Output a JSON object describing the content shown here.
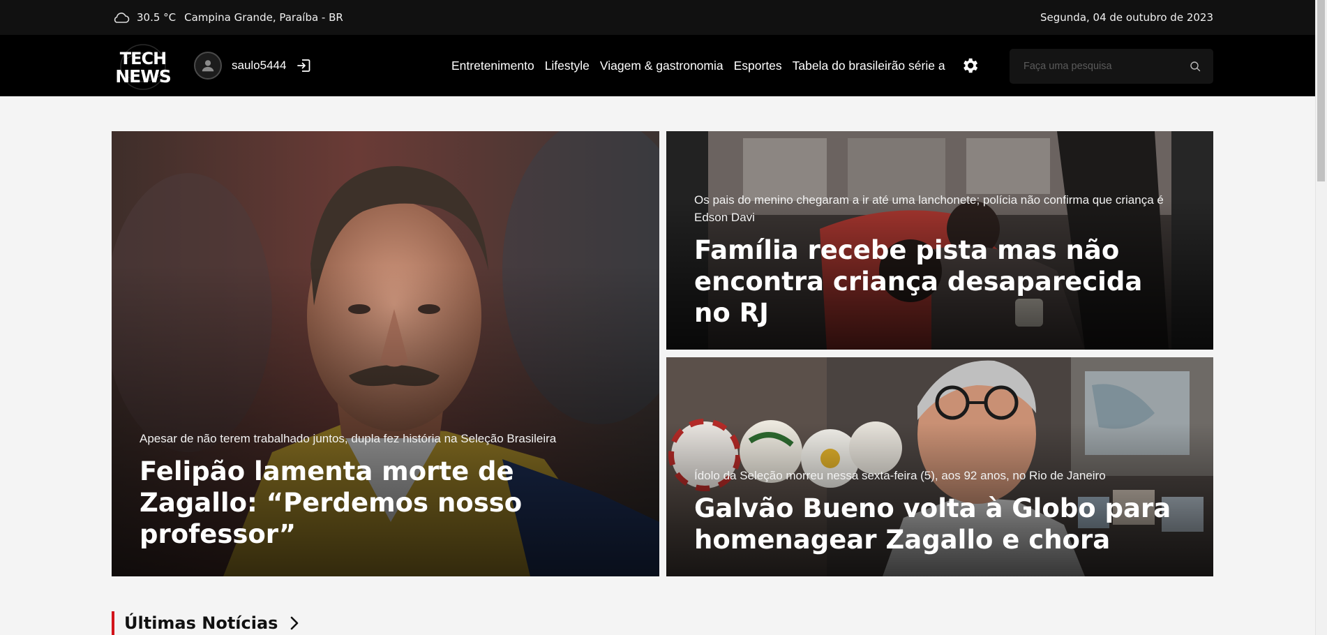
{
  "topbar": {
    "weather_icon": "cloud-icon",
    "temperature": "30.5 °C",
    "location": "Campina Grande, Paraíba - BR",
    "date": "Segunda, 04 de outubro de 2023"
  },
  "navbar": {
    "logo_text": [
      "TECH",
      "NEWS"
    ],
    "username": "saulo5444",
    "menu": [
      {
        "label": "Entretenimento"
      },
      {
        "label": "Lifestyle"
      },
      {
        "label": "Viagem & gastronomia"
      },
      {
        "label": "Esportes"
      },
      {
        "label": "Tabela do brasileirão série a"
      }
    ],
    "settings_icon": "gear-icon",
    "search_placeholder": "Faça uma pesquisa"
  },
  "featured": {
    "main": {
      "subtitle": "Apesar de não terem trabalhado juntos, dupla fez história na Seleção Brasileira",
      "headline": "Felipão lamenta morte de Zagallo: “Perdemos nosso professor”"
    },
    "top": {
      "subtitle": "Os pais do menino chegaram a ir até uma lanchonete; polícia não confirma que criança é Edson Davi",
      "headline": "Família recebe pista mas não encontra criança desaparecida no RJ"
    },
    "bottom": {
      "subtitle": "Ídolo da Seleção morreu nessa sexta-feira (5), aos 92 anos, no Rio de Janeiro",
      "headline": "Galvão Bueno volta à Globo para homenagear Zagallo e chora"
    }
  },
  "latest": {
    "title": "Últimas Notícias"
  },
  "colors": {
    "accent": "#d3141b",
    "topbar_bg": "#111111",
    "navbar_bg": "#000000",
    "page_bg": "#f4f4f4"
  }
}
